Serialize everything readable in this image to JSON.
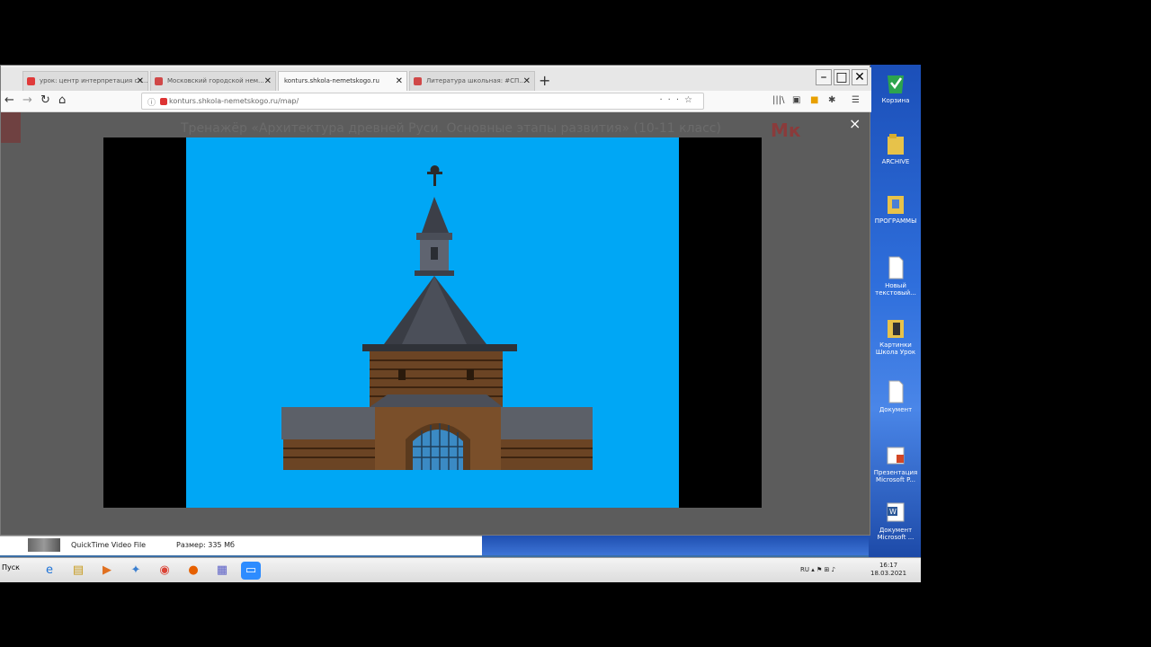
{
  "browser": {
    "tabs": [
      {
        "label": "урок: центр интерпретация сл...",
        "favicon_color": "#e03a3a",
        "active": false
      },
      {
        "label": "Московский городской нем...",
        "favicon_color": "#d04848",
        "active": false
      },
      {
        "label": "konturs.shkola-nemetskogo.ru",
        "favicon_color": "#999999",
        "active": true
      },
      {
        "label": "Литература школьная: #СП...",
        "favicon_color": "#d04848",
        "active": false
      }
    ],
    "new_tab": "+",
    "url": "konturs.shkola-nemetskogo.ru/map/",
    "window_controls": {
      "minimize": "–",
      "maximize": "□",
      "close": "✕"
    }
  },
  "page": {
    "title": "Тренажёр «Архитектура древней Руси. Основные этапы развития» (10-11 класс)",
    "logo": "Мк"
  },
  "lightbox": {
    "close": "×",
    "slide_bg": "#00a7f5",
    "image_subject": "wooden-tower-gate-icon"
  },
  "desktop_icons": [
    {
      "label": "Корзина",
      "icon": "recycle-bin-icon"
    },
    {
      "label": "ARCHIVE",
      "icon": "folder-icon"
    },
    {
      "label": "ПРОГРАММЫ",
      "icon": "folder-icon"
    },
    {
      "label": "Новый текстовый...",
      "icon": "document-icon"
    },
    {
      "label": "Картинки Школа Урок",
      "icon": "folder-icon"
    },
    {
      "label": "Документ",
      "icon": "document-icon"
    },
    {
      "label": "Презентация Microsoft P...",
      "icon": "powerpoint-icon"
    },
    {
      "label": "Документ Microsoft ...",
      "icon": "word-icon"
    }
  ],
  "details": {
    "name": "QuickTime Video File",
    "size": "Размер: 335 Мб"
  },
  "taskbar": {
    "start": "Пуск",
    "lang": "RU",
    "time": "16:17",
    "date": "18.03.2021"
  }
}
